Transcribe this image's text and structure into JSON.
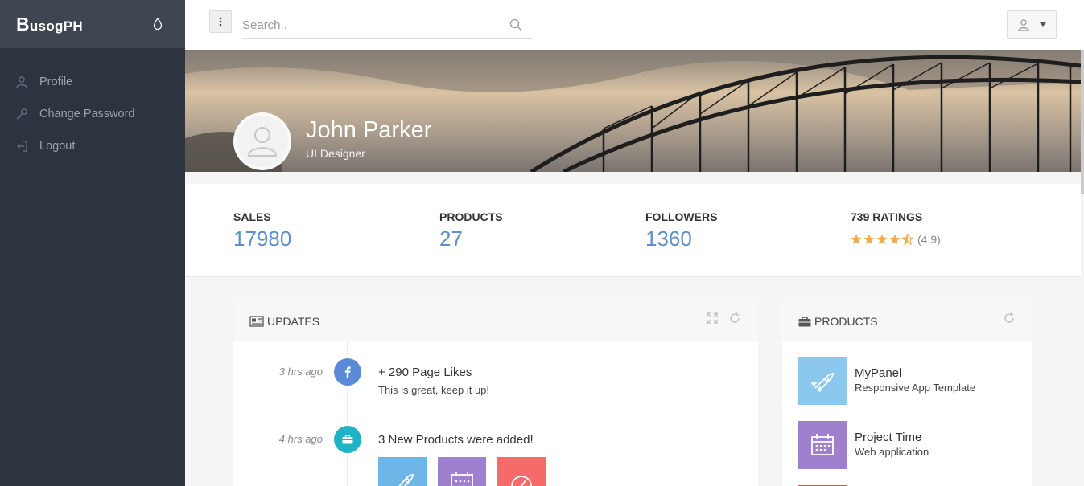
{
  "brand": {
    "first": "B",
    "rest": "usogPH"
  },
  "sidebar": {
    "items": [
      {
        "label": "Profile",
        "icon": "user-icon"
      },
      {
        "label": "Change Password",
        "icon": "key-icon"
      },
      {
        "label": "Logout",
        "icon": "logout-icon"
      }
    ]
  },
  "topbar": {
    "search_placeholder": "Search.."
  },
  "profile": {
    "name": "John Parker",
    "role": "UI Designer"
  },
  "stats": {
    "sales_label": "SALES",
    "sales_value": "17980",
    "products_label": "PRODUCTS",
    "products_value": "27",
    "followers_label": "FOLLOWERS",
    "followers_value": "1360",
    "ratings_label": "739 RATINGS",
    "rating_text": "(4.9)",
    "rating_value": 4.5
  },
  "updates": {
    "title": "UPDATES",
    "items": [
      {
        "time": "3 hrs ago",
        "title": "+ 290 Page Likes",
        "subtitle": "This is great, keep it up!",
        "icon": "facebook-icon",
        "color": "#5b8bd8"
      },
      {
        "time": "4 hrs ago",
        "title": "3 New Products were added!",
        "subtitle": "",
        "icon": "briefcase-icon",
        "color": "#1fb3c4"
      }
    ]
  },
  "products": {
    "title": "PRODUCTS",
    "items": [
      {
        "name": "MyPanel",
        "desc": "Responsive App Template",
        "icon": "rocket-icon",
        "color": "#8cc8ee"
      },
      {
        "name": "Project Time",
        "desc": "Web application",
        "icon": "calendar-icon",
        "color": "#9e80ce"
      }
    ]
  },
  "colors": {
    "sidebar": "#2c343f",
    "brand_bar": "#3e4651",
    "accent": "#5d8fc8",
    "star": "#f0ad4e",
    "red": "#f76a6a"
  }
}
